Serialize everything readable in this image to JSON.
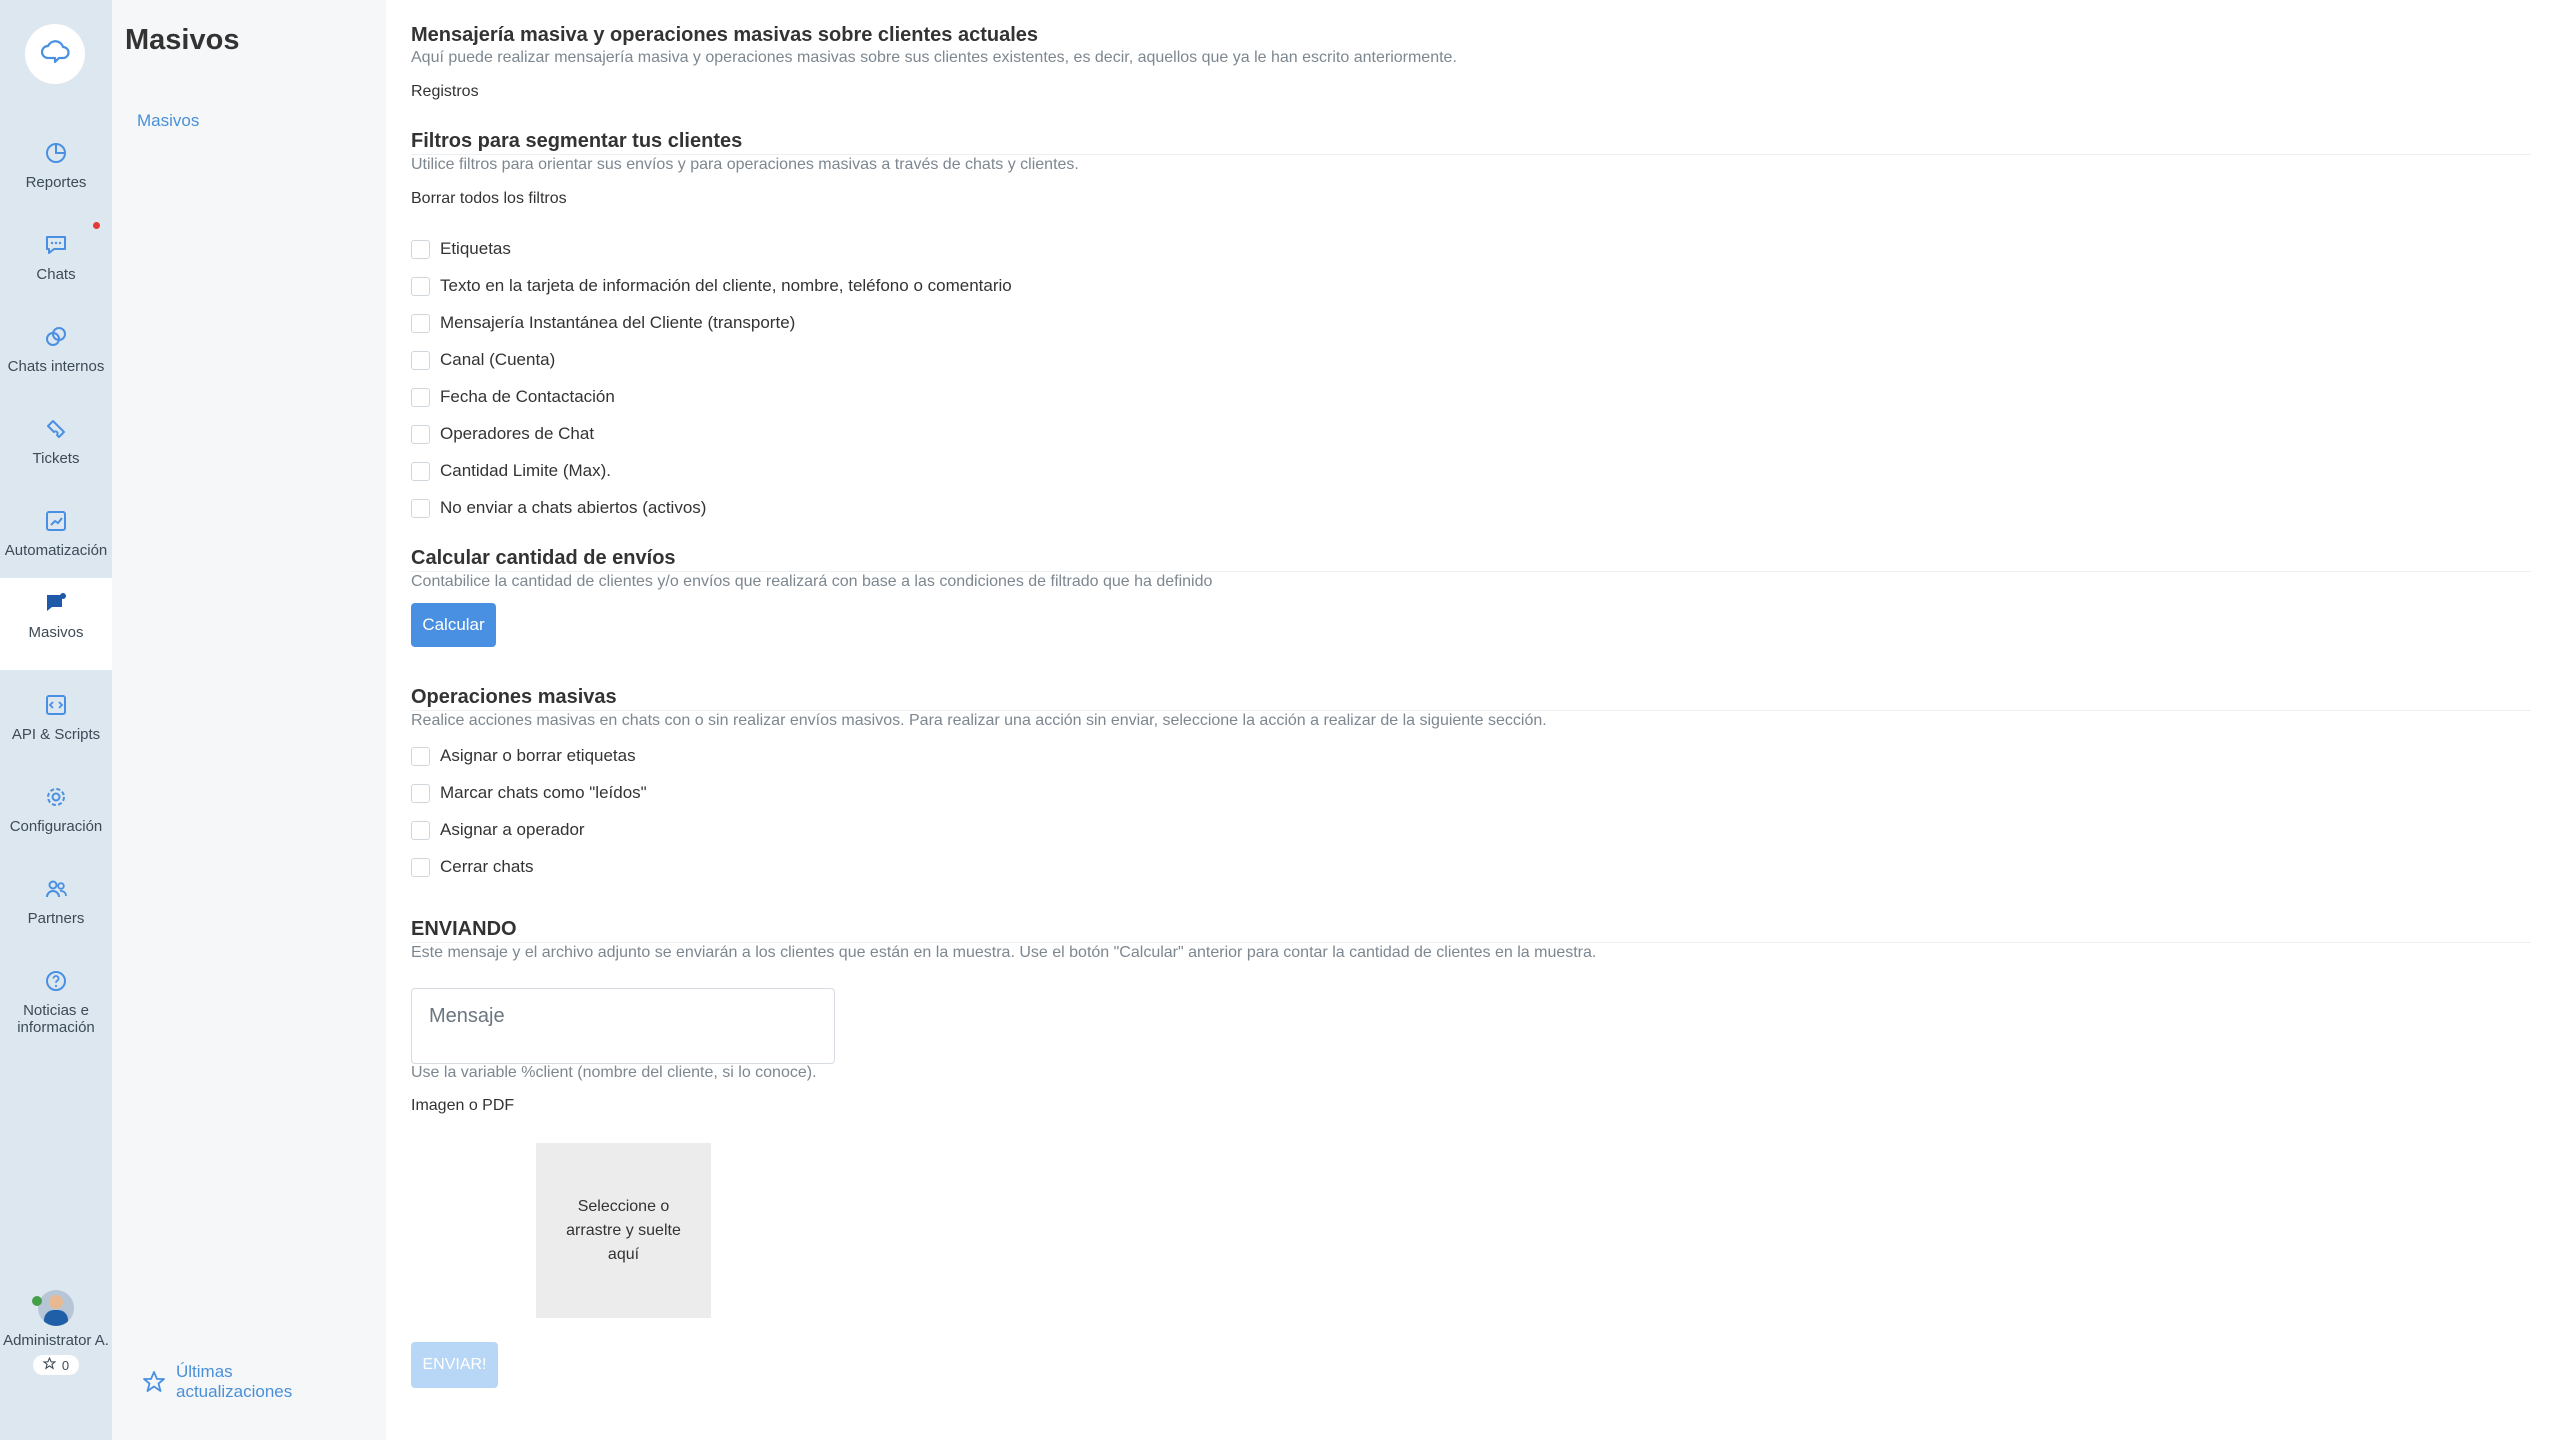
{
  "rail": {
    "items": [
      {
        "label": "Reportes",
        "icon": "pie-chart-icon"
      },
      {
        "label": "Chats",
        "icon": "chat-bubble-icon"
      },
      {
        "label": "Chats internos",
        "icon": "internal-chats-icon"
      },
      {
        "label": "Tickets",
        "icon": "ticket-icon"
      },
      {
        "label": "Automatización",
        "icon": "automation-icon"
      },
      {
        "label": "Masivos",
        "icon": "mass-message-icon"
      },
      {
        "label": "API & Scripts",
        "icon": "code-icon"
      },
      {
        "label": "Configuración",
        "icon": "gear-icon"
      },
      {
        "label": "Partners",
        "icon": "partners-icon"
      },
      {
        "label": "Noticias e información",
        "icon": "help-icon"
      }
    ],
    "user_name": "Administrator A.",
    "star_count": "0",
    "accent": "#4a90e2",
    "status_dot": "#e53935"
  },
  "panel": {
    "title": "Masivos",
    "link": "Masivos",
    "updates_line1": "Últimas",
    "updates_line2": "actualizaciones"
  },
  "main": {
    "title": "Mensajería masiva y operaciones masivas sobre clientes actuales",
    "subtitle": "Aquí puede realizar mensajería masiva y operaciones masivas sobre sus clientes existentes, es decir, aquellos que ya le han escrito anteriormente.",
    "registros": "Registros",
    "filters_title": "Filtros para segmentar tus clientes",
    "filters_sub": "Utilice filtros para orientar sus envíos y para operaciones masivas a través de chats y clientes.",
    "clear_filters": "Borrar todos los filtros",
    "filters": [
      "Etiquetas",
      "Texto en la tarjeta de información del cliente, nombre, teléfono o comentario",
      "Mensajería Instantánea del Cliente (transporte)",
      "Canal (Cuenta)",
      "Fecha de Contactación",
      "Operadores de Chat",
      "Cantidad Limite (Max).",
      "No enviar a chats abiertos (activos)"
    ],
    "calc_title": "Calcular cantidad de envíos",
    "calc_sub": "Contabilice la cantidad de clientes y/o envíos que realizará con base a las condiciones de filtrado que ha definido",
    "calc_button": "Calcular",
    "ops_title": "Operaciones masivas",
    "ops_sub": "Realice acciones masivas en chats con o sin realizar envíos masivos. Para realizar una acción sin enviar, seleccione la acción a realizar de la siguiente sección.",
    "ops": [
      "Asignar o borrar etiquetas",
      "Marcar chats como \"leídos\"",
      "Asignar a operador",
      "Cerrar chats"
    ],
    "send_title": "ENVIANDO",
    "send_sub": "Este mensaje y el archivo adjunto se enviarán a los clientes que están en la muestra. Use el botón \"Calcular\" anterior para contar la cantidad de clientes en la muestra.",
    "message_placeholder": "Mensaje",
    "variable_hint": "Use la variable %client (nombre del cliente, si lo conoce).",
    "attach_label": "Imagen o PDF",
    "drop_text": "Seleccione o arrastre y suelte aquí",
    "send_button": "ENVIAR!"
  }
}
